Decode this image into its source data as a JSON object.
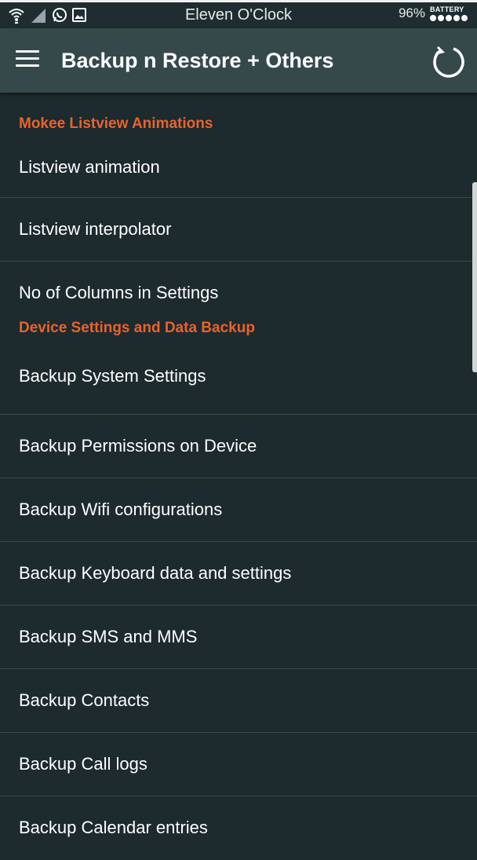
{
  "status_bar": {
    "carrier": "Eleven O'Clock",
    "battery_percent": "96%",
    "battery_label": "BATTERY",
    "icons": [
      "wifi-icon",
      "signal-icon",
      "whatsapp-icon",
      "image-icon"
    ]
  },
  "app_bar": {
    "title": "Backup n Restore + Others",
    "menu_icon": "hamburger-menu-icon",
    "action_icon": "refresh-icon"
  },
  "sections": [
    {
      "header": "Mokee Listview Animations",
      "items": [
        "Listview animation",
        "Listview interpolator",
        "No of Columns in Settings"
      ]
    },
    {
      "header": "Device Settings and Data Backup",
      "items": [
        "Backup System Settings",
        "Backup Permissions on Device",
        "Backup Wifi configurations",
        "Backup Keyboard data and settings",
        "Backup SMS and MMS",
        "Backup Contacts",
        "Backup Call logs",
        "Backup Calendar entries"
      ]
    }
  ],
  "colors": {
    "background": "#1d2a2e",
    "app_bar": "#35494b",
    "accent": "#e9632c",
    "divider": "#3a4a4e"
  }
}
